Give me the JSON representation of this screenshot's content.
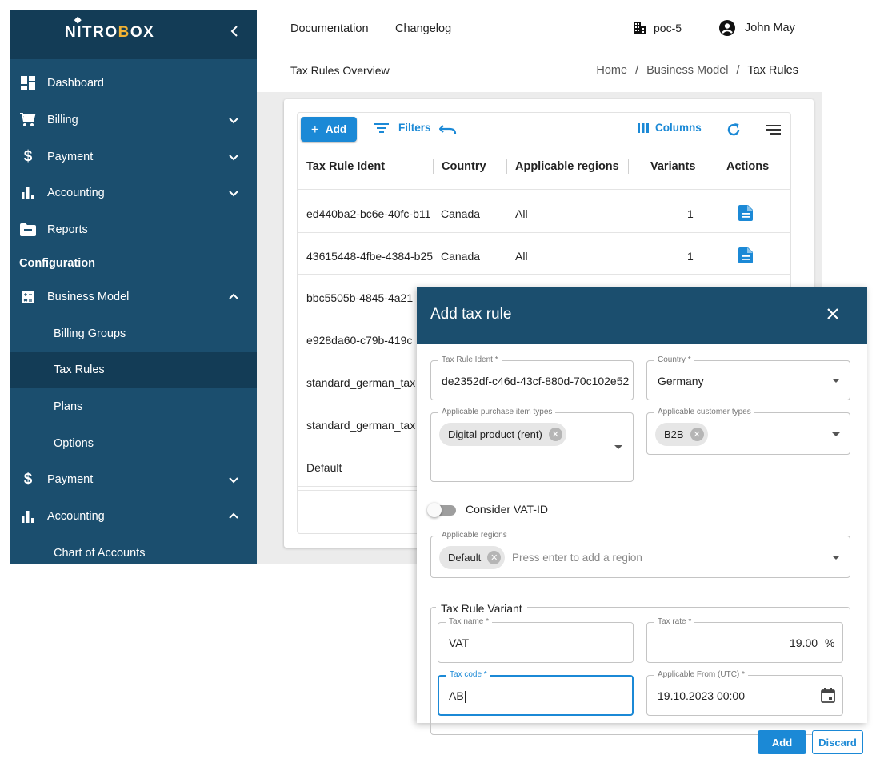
{
  "brand": {
    "logo_left": "NITRO",
    "logo_accent": "B",
    "logo_right": "OX"
  },
  "sidebar": {
    "section_title": "Configuration",
    "items": [
      {
        "label": "Dashboard",
        "icon": "dashboard-icon"
      },
      {
        "label": "Billing",
        "icon": "cart-icon",
        "expanded": false
      },
      {
        "label": "Payment",
        "icon": "dollar-icon",
        "expanded": false
      },
      {
        "label": "Accounting",
        "icon": "bar-chart-icon",
        "expanded": false
      },
      {
        "label": "Reports",
        "icon": "folder-icon"
      },
      {
        "label": "Business Model",
        "icon": "calculator-icon",
        "expanded": true
      },
      {
        "label": "Billing Groups"
      },
      {
        "label": "Tax Rules",
        "active": true
      },
      {
        "label": "Plans"
      },
      {
        "label": "Options"
      },
      {
        "label": "Payment",
        "icon": "dollar-icon",
        "expanded": false
      },
      {
        "label": "Accounting",
        "icon": "bar-chart-icon",
        "expanded": true
      },
      {
        "label": "Chart of Accounts"
      }
    ]
  },
  "header": {
    "links": [
      "Documentation",
      "Changelog"
    ],
    "org": "poc-5",
    "user": "John May",
    "page_title": "Tax Rules Overview",
    "breadcrumb": [
      "Home",
      "Business Model",
      "Tax Rules"
    ],
    "breadcrumb_sep": "/"
  },
  "toolbar": {
    "add": "Add",
    "filters": "Filters",
    "columns": "Columns"
  },
  "table": {
    "columns": [
      "Tax Rule Ident",
      "Country",
      "Applicable regions",
      "Variants",
      "Actions"
    ],
    "rows": [
      {
        "ident": "ed440ba2-bc6e-40fc-b11",
        "country": "Canada",
        "regions": "All",
        "variants": "1"
      },
      {
        "ident": "43615448-4fbe-4384-b25",
        "country": "Canada",
        "regions": "All",
        "variants": "1"
      },
      {
        "ident": "bbc5505b-4845-4a21"
      },
      {
        "ident": "e928da60-c79b-419c"
      },
      {
        "ident": "standard_german_tax"
      },
      {
        "ident": "standard_german_tax"
      },
      {
        "ident": "Default"
      }
    ]
  },
  "modal": {
    "title": "Add tax rule",
    "tax_rule_ident": {
      "label": "Tax Rule Ident *",
      "value": "de2352df-c46d-43cf-880d-70c102e52"
    },
    "country": {
      "label": "Country *",
      "value": "Germany"
    },
    "purchase_types": {
      "label": "Applicable purchase item types",
      "chips": [
        "Digital product (rent)"
      ]
    },
    "customer_types": {
      "label": "Applicable customer types",
      "chips": [
        "B2B"
      ]
    },
    "consider_vat": {
      "label": "Consider VAT-ID",
      "on": false
    },
    "regions": {
      "label": "Applicable regions",
      "chips": [
        "Default"
      ],
      "placeholder": "Press enter to add a region"
    },
    "variant": {
      "legend": "Tax Rule Variant",
      "tax_name": {
        "label": "Tax name *",
        "value": "VAT"
      },
      "tax_rate": {
        "label": "Tax rate *",
        "value": "19.00",
        "unit": "%"
      },
      "tax_code": {
        "label": "Tax code *",
        "value": "AB"
      },
      "applicable_from": {
        "label": "Applicable From (UTC) *",
        "value": "19.10.2023 00:00"
      }
    },
    "add_button": "Add",
    "discard_button": "Discard"
  },
  "colors": {
    "sidebar": "#1b4e6e",
    "sidebar_dark": "#133c56",
    "accent": "#1b89d6",
    "logo_accent": "#f2b233"
  }
}
